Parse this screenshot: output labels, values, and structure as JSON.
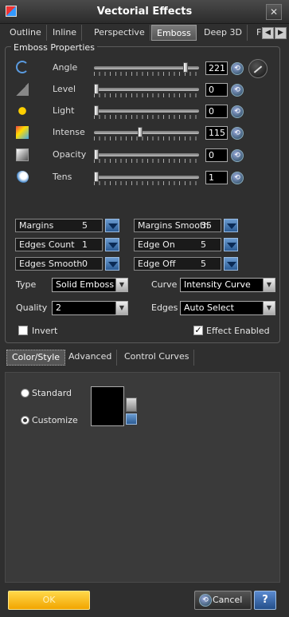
{
  "window": {
    "title": "Vectorial Effects",
    "close": "✕"
  },
  "tabs": [
    "Outline",
    "Inline",
    "Perspective",
    "Emboss",
    "Deep 3D",
    "F"
  ],
  "active_tab": "Emboss",
  "props": {
    "group_label": "Emboss Properties",
    "rows": [
      {
        "label": "Angle",
        "value": "221",
        "fraction": 0.89
      },
      {
        "label": "Level",
        "value": "0",
        "fraction": 0.0
      },
      {
        "label": "Light",
        "value": "0",
        "fraction": 0.0
      },
      {
        "label": "Intense",
        "value": "115",
        "fraction": 0.44
      },
      {
        "label": "Opacity",
        "value": "0",
        "fraction": 0.0
      },
      {
        "label": "Tens",
        "value": "1",
        "fraction": 0.0
      }
    ]
  },
  "spins": [
    {
      "label": "Margins",
      "value": "5"
    },
    {
      "label": "Margins Smooth",
      "value": "35"
    },
    {
      "label": "Edges Count",
      "value": "1"
    },
    {
      "label": "Edge On",
      "value": "5"
    },
    {
      "label": "Edges Smooth",
      "value": "0"
    },
    {
      "label": "Edge Off",
      "value": "5"
    }
  ],
  "selects": {
    "type_label": "Type",
    "type_value": "Solid Emboss",
    "curve_label": "Curve",
    "curve_value": "Intensity Curve",
    "quality_label": "Quality",
    "quality_value": "2",
    "edges_label": "Edges",
    "edges_value": "Auto Select"
  },
  "checks": {
    "invert": "Invert",
    "invert_checked": false,
    "effect": "Effect Enabled",
    "effect_checked": true
  },
  "subtabs": [
    "Color/Style",
    "Advanced",
    "Control Curves"
  ],
  "color": {
    "standard": "Standard",
    "customize": "Customize",
    "selected": "Customize",
    "swatch": "#000000"
  },
  "buttons": {
    "ok": "OK",
    "cancel": "Cancel",
    "help": "?"
  }
}
